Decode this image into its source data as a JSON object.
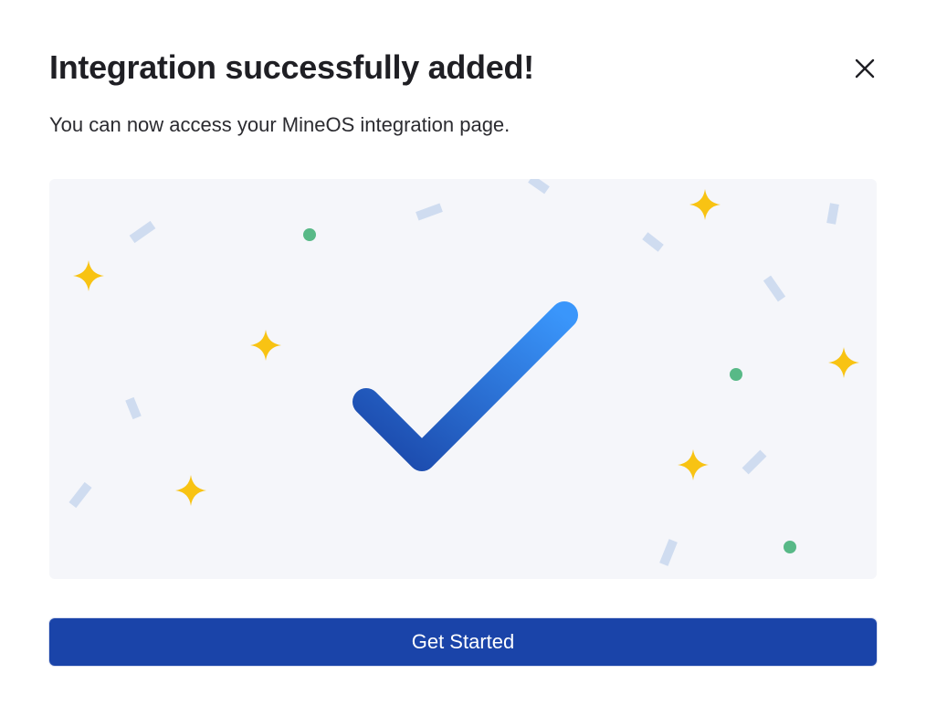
{
  "modal": {
    "title": "Integration successfully added!",
    "subtitle": "You can now access your MineOS integration page.",
    "close_icon": "close-icon",
    "illustration_icons": [
      "checkmark-icon",
      "sparkle-star-icon",
      "confetti-icon",
      "dot-icon"
    ],
    "cta_label": "Get Started"
  },
  "colors": {
    "accent": "#1a44a9",
    "check_start": "#1a46a8",
    "check_end": "#3a96fb",
    "star": "#f8c313",
    "dot": "#58b987",
    "confetti": "#cfdcf0",
    "illustration_bg": "#f5f6fa"
  }
}
